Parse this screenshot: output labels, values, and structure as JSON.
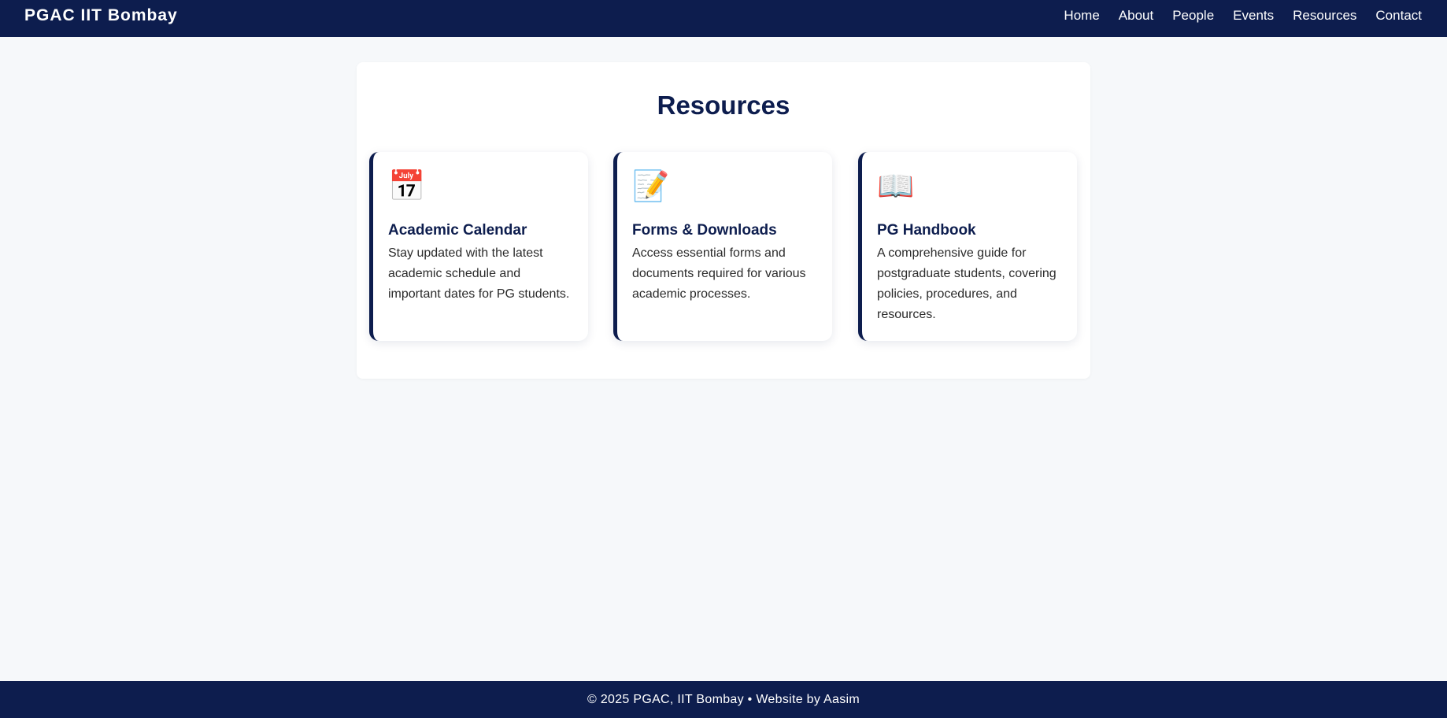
{
  "header": {
    "brand": "PGAC IIT Bombay",
    "nav": [
      "Home",
      "About",
      "People",
      "Events",
      "Resources",
      "Contact"
    ]
  },
  "main": {
    "title": "Resources",
    "cards": [
      {
        "icon": "calendar-icon",
        "glyph": "📅",
        "title": "Academic Calendar",
        "description": "Stay updated with the latest academic schedule and important dates for PG students."
      },
      {
        "icon": "memo-icon",
        "glyph": "📝",
        "title": "Forms & Downloads",
        "description": "Access essential forms and documents required for various academic processes."
      },
      {
        "icon": "book-icon",
        "glyph": "📖",
        "title": "PG Handbook",
        "description": "A comprehensive guide for postgraduate students, covering policies, procedures, and resources."
      }
    ]
  },
  "footer": {
    "text": "© 2025 PGAC, IIT Bombay • Website by Aasim"
  },
  "colors": {
    "primary": "#0d1d4e",
    "background": "#f6f8fa",
    "card": "#ffffff"
  }
}
